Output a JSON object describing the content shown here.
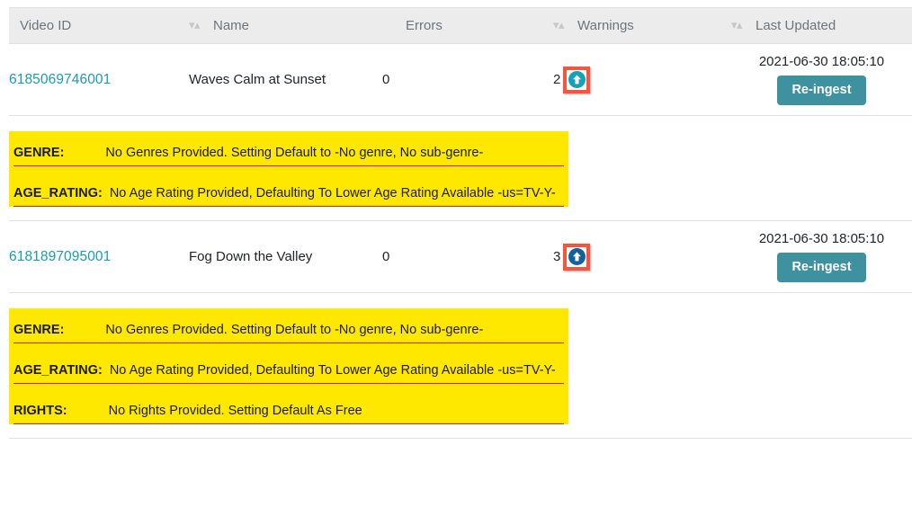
{
  "table": {
    "columns": [
      {
        "key": "video_id",
        "label": "Video ID",
        "sortable": false,
        "sort_icon": "sort-updown-icon"
      },
      {
        "key": "name",
        "label": "Name",
        "sortable": true,
        "sort_icon": "sort-updown-icon"
      },
      {
        "key": "errors",
        "label": "Errors",
        "sortable": false,
        "sort_icon": "sort-updown-icon"
      },
      {
        "key": "warnings",
        "label": "Warnings",
        "sortable": true,
        "sort_icon": "sort-updown-icon"
      },
      {
        "key": "last_updated",
        "label": "Last Updated",
        "sortable": true,
        "sort_icon": "sort-updown-icon"
      }
    ],
    "rows": [
      {
        "video_id": "6185069746001",
        "name": "Waves Calm at Sunset",
        "errors": "0",
        "warnings_count": "2",
        "warnings_toggle_icon": "upload-circle-arrow-icon",
        "warnings_toggle_color": "#14a2b8",
        "highlighted": true,
        "last_updated": "2021-06-30 18:05:10",
        "action_label": "Re-ingest",
        "warnings": [
          {
            "key": "GENRE:",
            "message": "No Genres Provided. Setting Default to -No genre, No sub-genre-"
          },
          {
            "key": "AGE_RATING:",
            "message": "No Age Rating Provided, Defaulting To Lower Age Rating Available -us=TV-Y-"
          }
        ]
      },
      {
        "video_id": "6181897095001",
        "name": "Fog Down the Valley",
        "errors": "0",
        "warnings_count": "3",
        "warnings_toggle_icon": "upload-circle-arrow-icon",
        "warnings_toggle_color": "#12619f",
        "highlighted": true,
        "last_updated": "2021-06-30 18:05:10",
        "action_label": "Re-ingest",
        "warnings": [
          {
            "key": "GENRE:",
            "message": "No Genres Provided. Setting Default to -No genre, No sub-genre-"
          },
          {
            "key": "AGE_RATING:",
            "message": "No Age Rating Provided, Defaulting To Lower Age Rating Available -us=TV-Y-"
          },
          {
            "key": "RIGHTS:",
            "message": "No Rights Provided. Setting Default As Free"
          }
        ]
      }
    ]
  },
  "colors": {
    "link": "#1b9cb0",
    "button": "#3e929f",
    "warning_panel_bg": "#ffe800",
    "warning_rule": "#e01b1b",
    "highlight_box": "#f4553e",
    "header_bg": "#ececec"
  }
}
